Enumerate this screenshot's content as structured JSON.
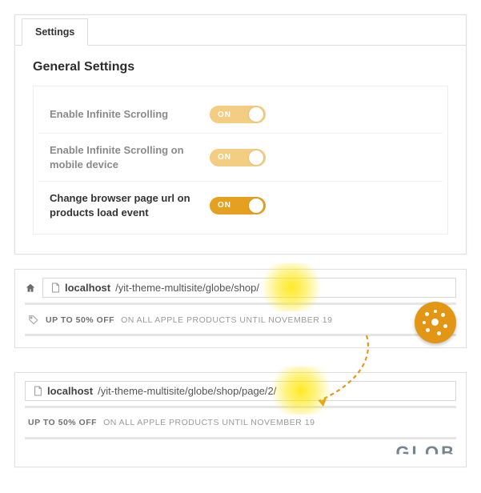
{
  "tab": {
    "label": "Settings"
  },
  "section_title": "General Settings",
  "rows": [
    {
      "label": "Enable Infinite Scrolling",
      "toggle_text": "ON",
      "variant": "light"
    },
    {
      "label": "Enable Infinite Scrolling on mobile device",
      "toggle_text": "ON",
      "variant": "light"
    },
    {
      "label": "Change browser page url on products load event",
      "toggle_text": "ON",
      "variant": "dark"
    }
  ],
  "browser1": {
    "url_host": "localhost",
    "url_path": "/yit-theme-multisite/globe/shop/",
    "promo_bold": "UP TO 50% OFF",
    "promo_rest": " ON ALL APPLE PRODUCTS UNTIL NOVEMBER 19"
  },
  "browser2": {
    "url_host": "localhost",
    "url_path": "/yit-theme-multisite/globe/shop/page/2/",
    "promo_bold": "UP TO 50% OFF",
    "promo_rest": " ON ALL APPLE PRODUCTS UNTIL NOVEMBER 19"
  },
  "brand_partial": "GLOB",
  "colors": {
    "toggle_light": "#f3cd82",
    "toggle_dark": "#e5a020",
    "glow": "#ffeb00",
    "arrow": "#e09a1e"
  }
}
